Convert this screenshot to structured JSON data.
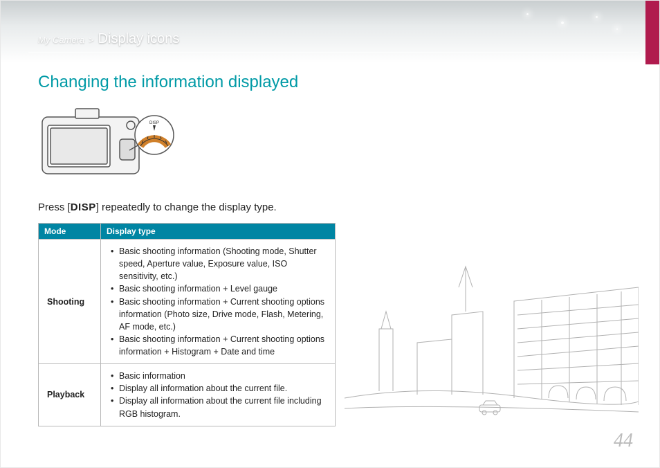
{
  "breadcrumb": {
    "root": "My Camera",
    "sep": ">",
    "leaf": "Display icons"
  },
  "section_title": "Changing the information displayed",
  "instruction": {
    "pre": "Press [",
    "button": "DISP",
    "post": "] repeatedly to change the display type."
  },
  "table": {
    "headers": {
      "mode": "Mode",
      "type": "Display type"
    },
    "rows": [
      {
        "mode": "Shooting",
        "items": [
          "Basic shooting information (Shooting mode, Shutter speed, Aperture value, Exposure value, ISO sensitivity, etc.)",
          "Basic shooting information + Level gauge",
          "Basic shooting information + Current shooting options information (Photo size, Drive mode, Flash, Metering, AF mode, etc.)",
          "Basic shooting information + Current shooting options information + Histogram + Date and time"
        ]
      },
      {
        "mode": "Playback",
        "items": [
          "Basic information",
          "Display all information about the current file.",
          "Display all information about the current file including RGB histogram."
        ]
      }
    ]
  },
  "page_number": "44",
  "icons": {
    "disp_callout": "DISP"
  }
}
